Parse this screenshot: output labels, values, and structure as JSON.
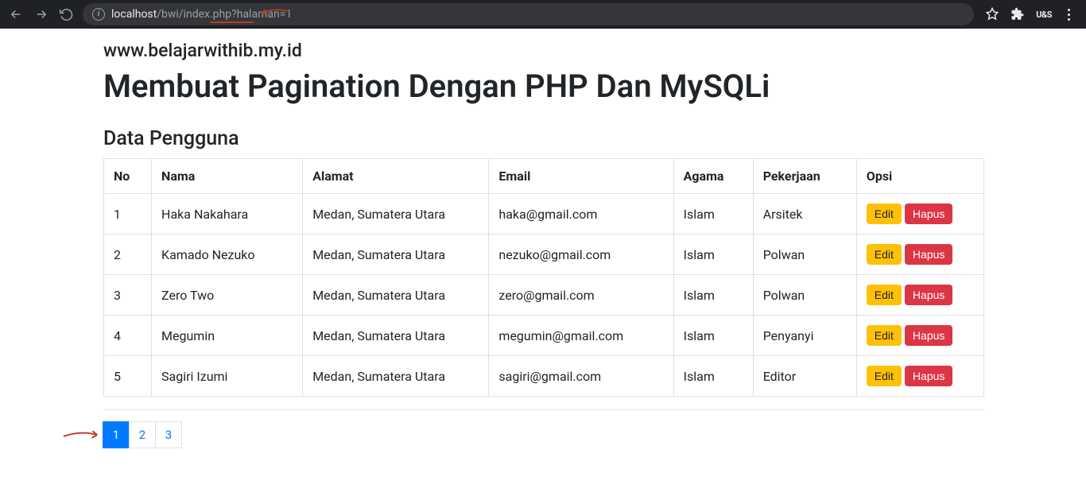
{
  "browser": {
    "url_host": "localhost",
    "url_path": "/bwi/index.php?halaman=1"
  },
  "page": {
    "site_url": "www.belajarwithib.my.id",
    "heading": "Membuat Pagination Dengan PHP Dan MySQLi",
    "section_title": "Data Pengguna"
  },
  "table": {
    "headers": {
      "no": "No",
      "nama": "Nama",
      "alamat": "Alamat",
      "email": "Email",
      "agama": "Agama",
      "pekerjaan": "Pekerjaan",
      "opsi": "Opsi"
    },
    "rows": [
      {
        "no": "1",
        "nama": "Haka Nakahara",
        "alamat": "Medan, Sumatera Utara",
        "email": "haka@gmail.com",
        "agama": "Islam",
        "pekerjaan": "Arsitek"
      },
      {
        "no": "2",
        "nama": "Kamado Nezuko",
        "alamat": "Medan, Sumatera Utara",
        "email": "nezuko@gmail.com",
        "agama": "Islam",
        "pekerjaan": "Polwan"
      },
      {
        "no": "3",
        "nama": "Zero Two",
        "alamat": "Medan, Sumatera Utara",
        "email": "zero@gmail.com",
        "agama": "Islam",
        "pekerjaan": "Polwan"
      },
      {
        "no": "4",
        "nama": "Megumin",
        "alamat": "Medan, Sumatera Utara",
        "email": "megumin@gmail.com",
        "agama": "Islam",
        "pekerjaan": "Penyanyi"
      },
      {
        "no": "5",
        "nama": "Sagiri Izumi",
        "alamat": "Medan, Sumatera Utara",
        "email": "sagiri@gmail.com",
        "agama": "Islam",
        "pekerjaan": "Editor"
      }
    ]
  },
  "actions": {
    "edit_label": "Edit",
    "hapus_label": "Hapus"
  },
  "pagination": {
    "pages": [
      "1",
      "2",
      "3"
    ],
    "active": "1"
  }
}
